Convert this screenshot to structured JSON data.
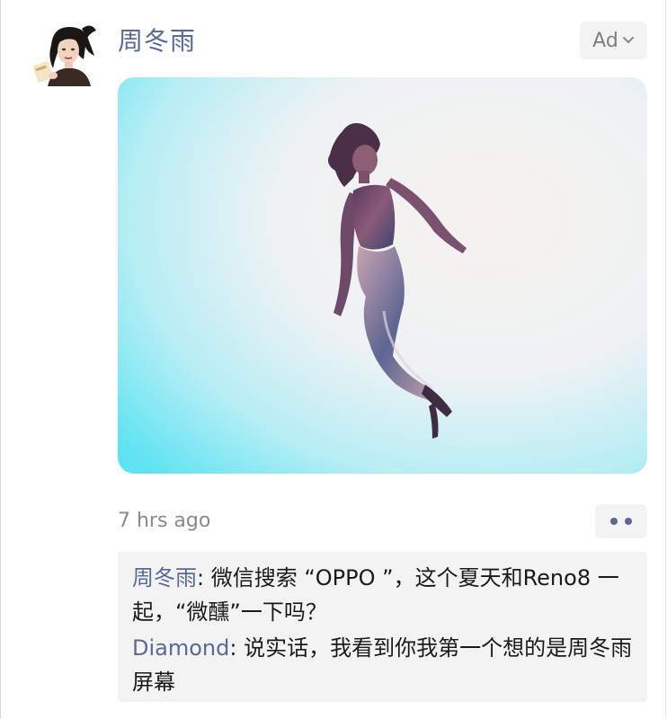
{
  "post": {
    "author": "周冬雨",
    "ad_label": "Ad",
    "ad_icon": "chevron-down-icon",
    "timestamp": "7 hrs ago",
    "more_icon": "more-dots-icon"
  },
  "comments": [
    {
      "user": "周冬雨",
      "separator": ": ",
      "text": "微信搜索 “OPPO ”，这个夏天和Reno8 一起，“微醺”一下吗？"
    },
    {
      "user": "Diamond",
      "separator": ": ",
      "text": "说实话，我看到你我第一个想的是周冬雨屏幕"
    }
  ],
  "colors": {
    "link": "#576b95",
    "muted": "#8a8a8a",
    "chip_bg": "#f3f3f3",
    "photo_cyan": "#5fe3f2"
  }
}
